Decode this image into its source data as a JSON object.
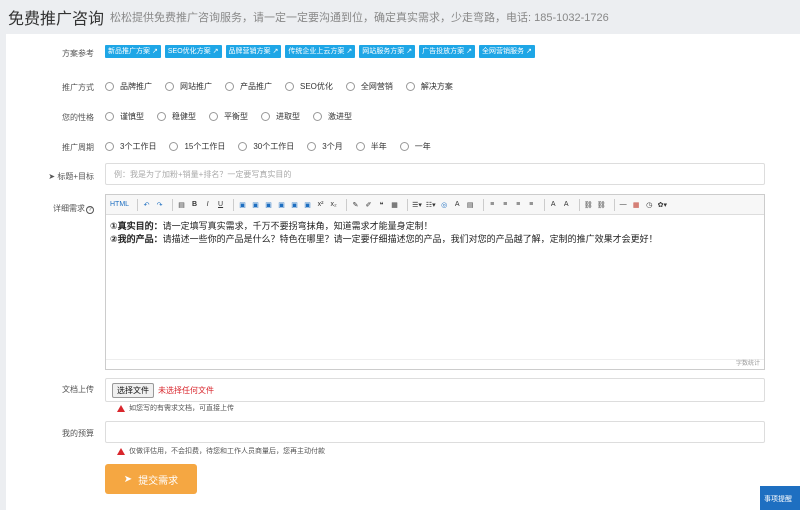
{
  "header": {
    "title": "免费推广咨询",
    "subtitle": "松松提供免费推广咨询服务，请一定一定要沟通到位，确定真实需求，少走弯路，电话: 185-1032-1726"
  },
  "form": {
    "scheme_label": "方案参考",
    "scheme_tags": [
      "新品推广方案",
      "SEO优化方案",
      "品牌营销方案",
      "传统企业上云方案",
      "网站服务方案",
      "广告投放方案",
      "全网营销服务"
    ],
    "method_label": "推广方式",
    "method_options": [
      "品牌推广",
      "网站推广",
      "产品推广",
      "SEO优化",
      "全网营销",
      "解决方案"
    ],
    "personality_label": "您的性格",
    "personality_options": [
      "谨慎型",
      "稳健型",
      "平衡型",
      "进取型",
      "激进型"
    ],
    "cycle_label": "推广周期",
    "cycle_options": [
      "3个工作日",
      "15个工作日",
      "30个工作日",
      "3个月",
      "半年",
      "一年"
    ],
    "title_label": "标题+目标",
    "title_placeholder": "例：我是为了加粉+销量+排名？一定要写真实目的",
    "detail_label": "详细需求",
    "editor": {
      "line1_prefix": "①真实目的：",
      "line1_text": "请一定填写真实需求，千万不要拐弯抹角，知道需求才能量身定制！",
      "line2_prefix": "②我的产品：",
      "line2_text": "请描述一些你的产品是什么？特色在哪里？请一定要仔细描述您的产品，我们对您的产品越了解，定制的推广效果才会更好！",
      "word_count": "字数统计"
    },
    "upload_label": "文档上传",
    "upload_button": "选择文件",
    "upload_status": "未选择任何文件",
    "upload_hint": "如您写的有需求文档，可直接上传",
    "budget_label": "我的预算",
    "budget_hint": "仅做评估用，不会扣费，待您和工作人员商量后，您再主动付款",
    "submit_label": "提交需求",
    "corner_label": "事项提醒"
  },
  "colors": {
    "tag_blue": "#1ea6e6",
    "submit_orange": "#f5a742",
    "warning_red": "#d9262c"
  }
}
